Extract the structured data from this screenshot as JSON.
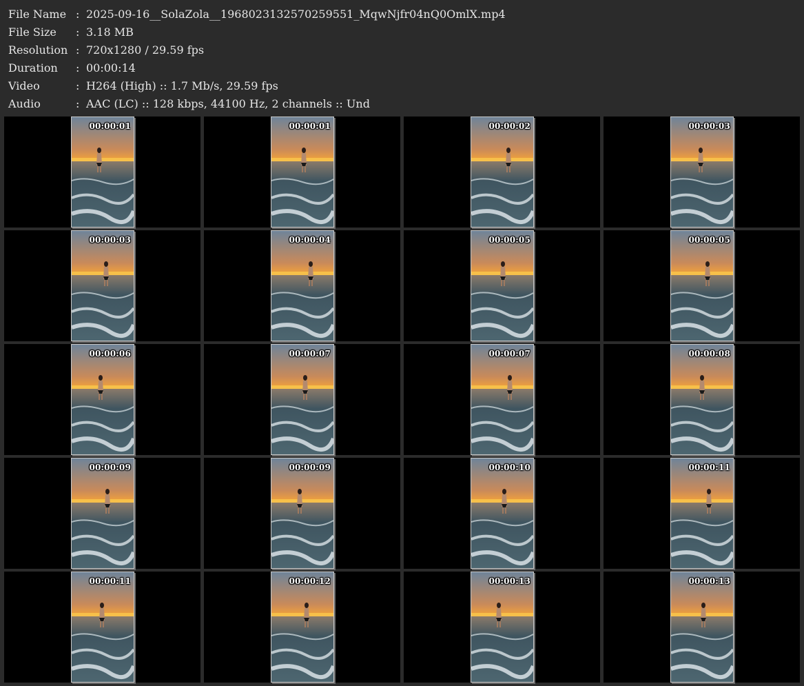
{
  "info": [
    {
      "label": "File Name",
      "value": "2025-09-16__SolaZola__1968023132570259551_MqwNjfr04nQ0OmlX.mp4"
    },
    {
      "label": "File Size",
      "value": "3.18 MB"
    },
    {
      "label": "Resolution",
      "value": "720x1280 / 29.59 fps"
    },
    {
      "label": "Duration",
      "value": "00:00:14"
    },
    {
      "label": "Video",
      "value": "H264 (High) :: 1.7 Mb/s, 29.59 fps"
    },
    {
      "label": "Audio",
      "value": "AAC (LC) :: 128 kbps, 44100 Hz, 2 channels :: Und"
    }
  ],
  "separator": ":",
  "thumbnails": [
    {
      "timestamp": "00:00:01"
    },
    {
      "timestamp": "00:00:01"
    },
    {
      "timestamp": "00:00:02"
    },
    {
      "timestamp": "00:00:03"
    },
    {
      "timestamp": "00:00:03"
    },
    {
      "timestamp": "00:00:04"
    },
    {
      "timestamp": "00:00:05"
    },
    {
      "timestamp": "00:00:05"
    },
    {
      "timestamp": "00:00:06"
    },
    {
      "timestamp": "00:00:07"
    },
    {
      "timestamp": "00:00:07"
    },
    {
      "timestamp": "00:00:08"
    },
    {
      "timestamp": "00:00:09"
    },
    {
      "timestamp": "00:00:09"
    },
    {
      "timestamp": "00:00:10"
    },
    {
      "timestamp": "00:00:11"
    },
    {
      "timestamp": "00:00:11"
    },
    {
      "timestamp": "00:00:12"
    },
    {
      "timestamp": "00:00:13"
    },
    {
      "timestamp": "00:00:13"
    }
  ],
  "colors": {
    "background": "#2b2b2b",
    "cell": "#000000",
    "text": "#e6e6e6",
    "sky_top": "#6f8499",
    "sky_horizon": "#f2a23a",
    "sea": "#3f5560",
    "foam": "#d9e2e6"
  }
}
